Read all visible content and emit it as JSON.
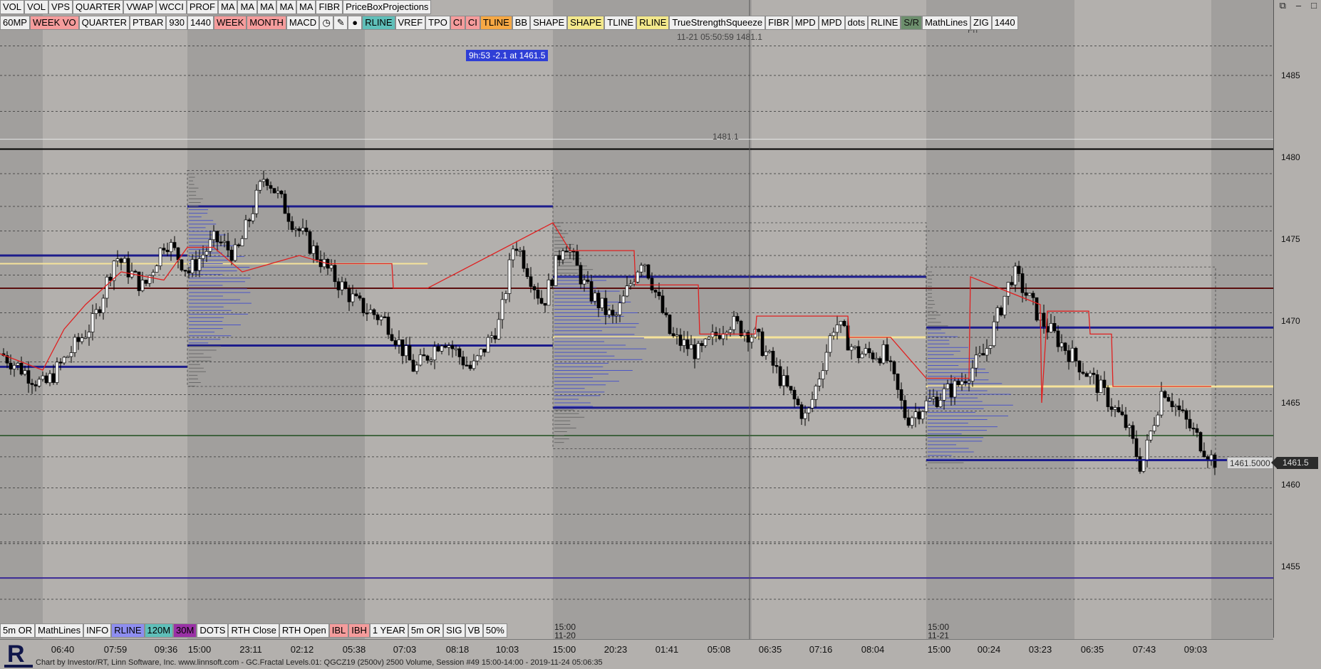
{
  "window_controls": {
    "restore": "⧉",
    "minimize": "–",
    "maximize": "□"
  },
  "top_toolbar_1": [
    "VOL",
    "VOL",
    "VPS",
    "QUARTER",
    "VWAP",
    "WCCI",
    "PROF",
    "MA",
    "MA",
    "MA",
    "MA",
    "MA",
    "FIBR",
    "PriceBoxProjections"
  ],
  "top_toolbar_2": [
    {
      "label": "60MP",
      "style": ""
    },
    {
      "label": "WEEK VO",
      "style": "pink"
    },
    {
      "label": "QUARTER",
      "style": ""
    },
    {
      "label": "PTBAR",
      "style": ""
    },
    {
      "label": "930",
      "style": ""
    },
    {
      "label": "1440",
      "style": ""
    },
    {
      "label": "WEEK",
      "style": "pink"
    },
    {
      "label": "MONTH",
      "style": "pink"
    },
    {
      "label": "MACD",
      "style": ""
    },
    {
      "label": "clock-icon",
      "style": "icon"
    },
    {
      "label": "pencil-icon",
      "style": "icon"
    },
    {
      "label": "drop-icon",
      "style": "icon"
    },
    {
      "label": "RLINE",
      "style": "teal"
    },
    {
      "label": "VREF",
      "style": ""
    },
    {
      "label": "TPO",
      "style": ""
    },
    {
      "label": "CI",
      "style": "pink"
    },
    {
      "label": "CI",
      "style": "pink"
    },
    {
      "label": "TLINE",
      "style": "orange"
    },
    {
      "label": "BB",
      "style": ""
    },
    {
      "label": "SHAPE",
      "style": ""
    },
    {
      "label": "SHAPE",
      "style": "yellow"
    },
    {
      "label": "TLINE",
      "style": ""
    },
    {
      "label": "RLINE",
      "style": "yellow"
    },
    {
      "label": "TrueStrengthSqueeze",
      "style": ""
    },
    {
      "label": "FIBR",
      "style": ""
    },
    {
      "label": "MPD",
      "style": ""
    },
    {
      "label": "MPD",
      "style": ""
    },
    {
      "label": "dots",
      "style": ""
    },
    {
      "label": "RLINE",
      "style": ""
    },
    {
      "label": "S/R",
      "style": "green"
    },
    {
      "label": "MathLines",
      "style": ""
    },
    {
      "label": "ZIG",
      "style": ""
    },
    {
      "label": "1440",
      "style": ""
    }
  ],
  "bottom_toolbar": [
    {
      "label": "5m OR",
      "style": ""
    },
    {
      "label": "MathLines",
      "style": ""
    },
    {
      "label": "INFO",
      "style": ""
    },
    {
      "label": "RLINE",
      "style": "blue"
    },
    {
      "label": "120M",
      "style": "teal"
    },
    {
      "label": "30M",
      "style": "purple"
    },
    {
      "label": "DOTS",
      "style": ""
    },
    {
      "label": "RTH Close",
      "style": ""
    },
    {
      "label": "RTH Open",
      "style": ""
    },
    {
      "label": "IBL",
      "style": "pink"
    },
    {
      "label": "IBH",
      "style": "pink"
    },
    {
      "label": "1 YEAR",
      "style": ""
    },
    {
      "label": "5m OR",
      "style": ""
    },
    {
      "label": "SIG",
      "style": ""
    },
    {
      "label": "VB",
      "style": ""
    },
    {
      "label": "50%",
      "style": ""
    }
  ],
  "overlay": {
    "crosshair_readout": "11-21 05:50:59 1481.1",
    "crosshair_price": "1481.1",
    "day_label": "Fri",
    "measure_tag": "9h:53 -2.1 at 1461.5",
    "session_1_time": "15:00",
    "session_1_date": "11-20",
    "session_2_time": "15:00",
    "session_2_date": "11-21"
  },
  "price_axis": {
    "labels": [
      "1485",
      "1480",
      "1475",
      "1470",
      "1465",
      "1460",
      "1455"
    ],
    "current_price": "1461.5",
    "current_line_label": "1461.5000"
  },
  "time_axis": {
    "labels": [
      "06:40",
      "07:59",
      "09:36",
      "15:00",
      "23:11",
      "02:12",
      "05:38",
      "07:03",
      "08:18",
      "10:03",
      "15:00",
      "20:23",
      "01:41",
      "05:08",
      "06:35",
      "07:16",
      "08:04",
      "15:00",
      "00:24",
      "03:23",
      "06:35",
      "07:43",
      "09:03"
    ]
  },
  "status_bar": {
    "text": "Chart by Investor/RT, Linn Software, Inc. www.linnsoft.com - GC.Fractal Levels.01: QGCZ19 (2500v) 2500 Volume, Session #49 15:00-14:00 - 2019-11-24 05:06:35"
  },
  "colors": {
    "background": "#b3b0ad",
    "shade_band": "#a19f9d",
    "candle_up": "#ffffff",
    "candle_down": "#000000",
    "level_blue": "#1c1c8c",
    "level_maroon": "#5a0d0d",
    "level_yellow": "#f6e39a",
    "level_purple": "#3a2896",
    "level_green": "#1f4f1f",
    "profile_blue": "#4b55c6",
    "profile_gray": "#6a6a6a",
    "vwap_red": "#e02020"
  }
}
